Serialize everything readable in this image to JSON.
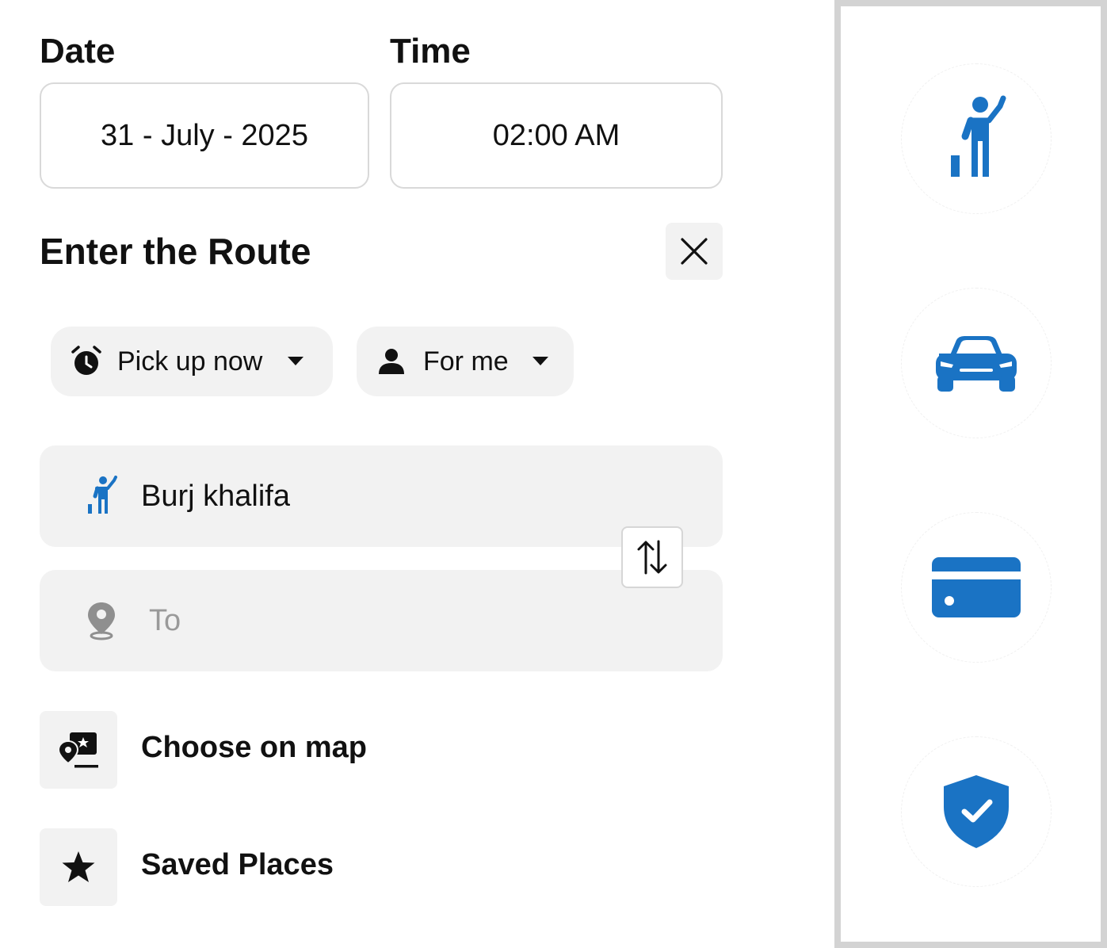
{
  "date": {
    "label": "Date",
    "value": "31 - July - 2025"
  },
  "time": {
    "label": "Time",
    "value": "02:00 AM"
  },
  "route": {
    "title": "Enter the Route"
  },
  "chips": {
    "pickup": "Pick up now",
    "for_whom": "For me"
  },
  "inputs": {
    "from_value": "Burj khalifa",
    "to_placeholder": "To"
  },
  "actions": {
    "choose_on_map": "Choose on map",
    "saved_places": "Saved Places"
  },
  "steps": [
    {
      "icon": "person-waving-icon"
    },
    {
      "icon": "car-icon"
    },
    {
      "icon": "credit-card-icon"
    },
    {
      "icon": "shield-check-icon"
    }
  ],
  "colors": {
    "accent": "#1a73c4",
    "chip_bg": "#f2f2f2",
    "border": "#d9d9d9",
    "panel_border": "#d3d3d3",
    "placeholder": "#9a9a9a"
  }
}
